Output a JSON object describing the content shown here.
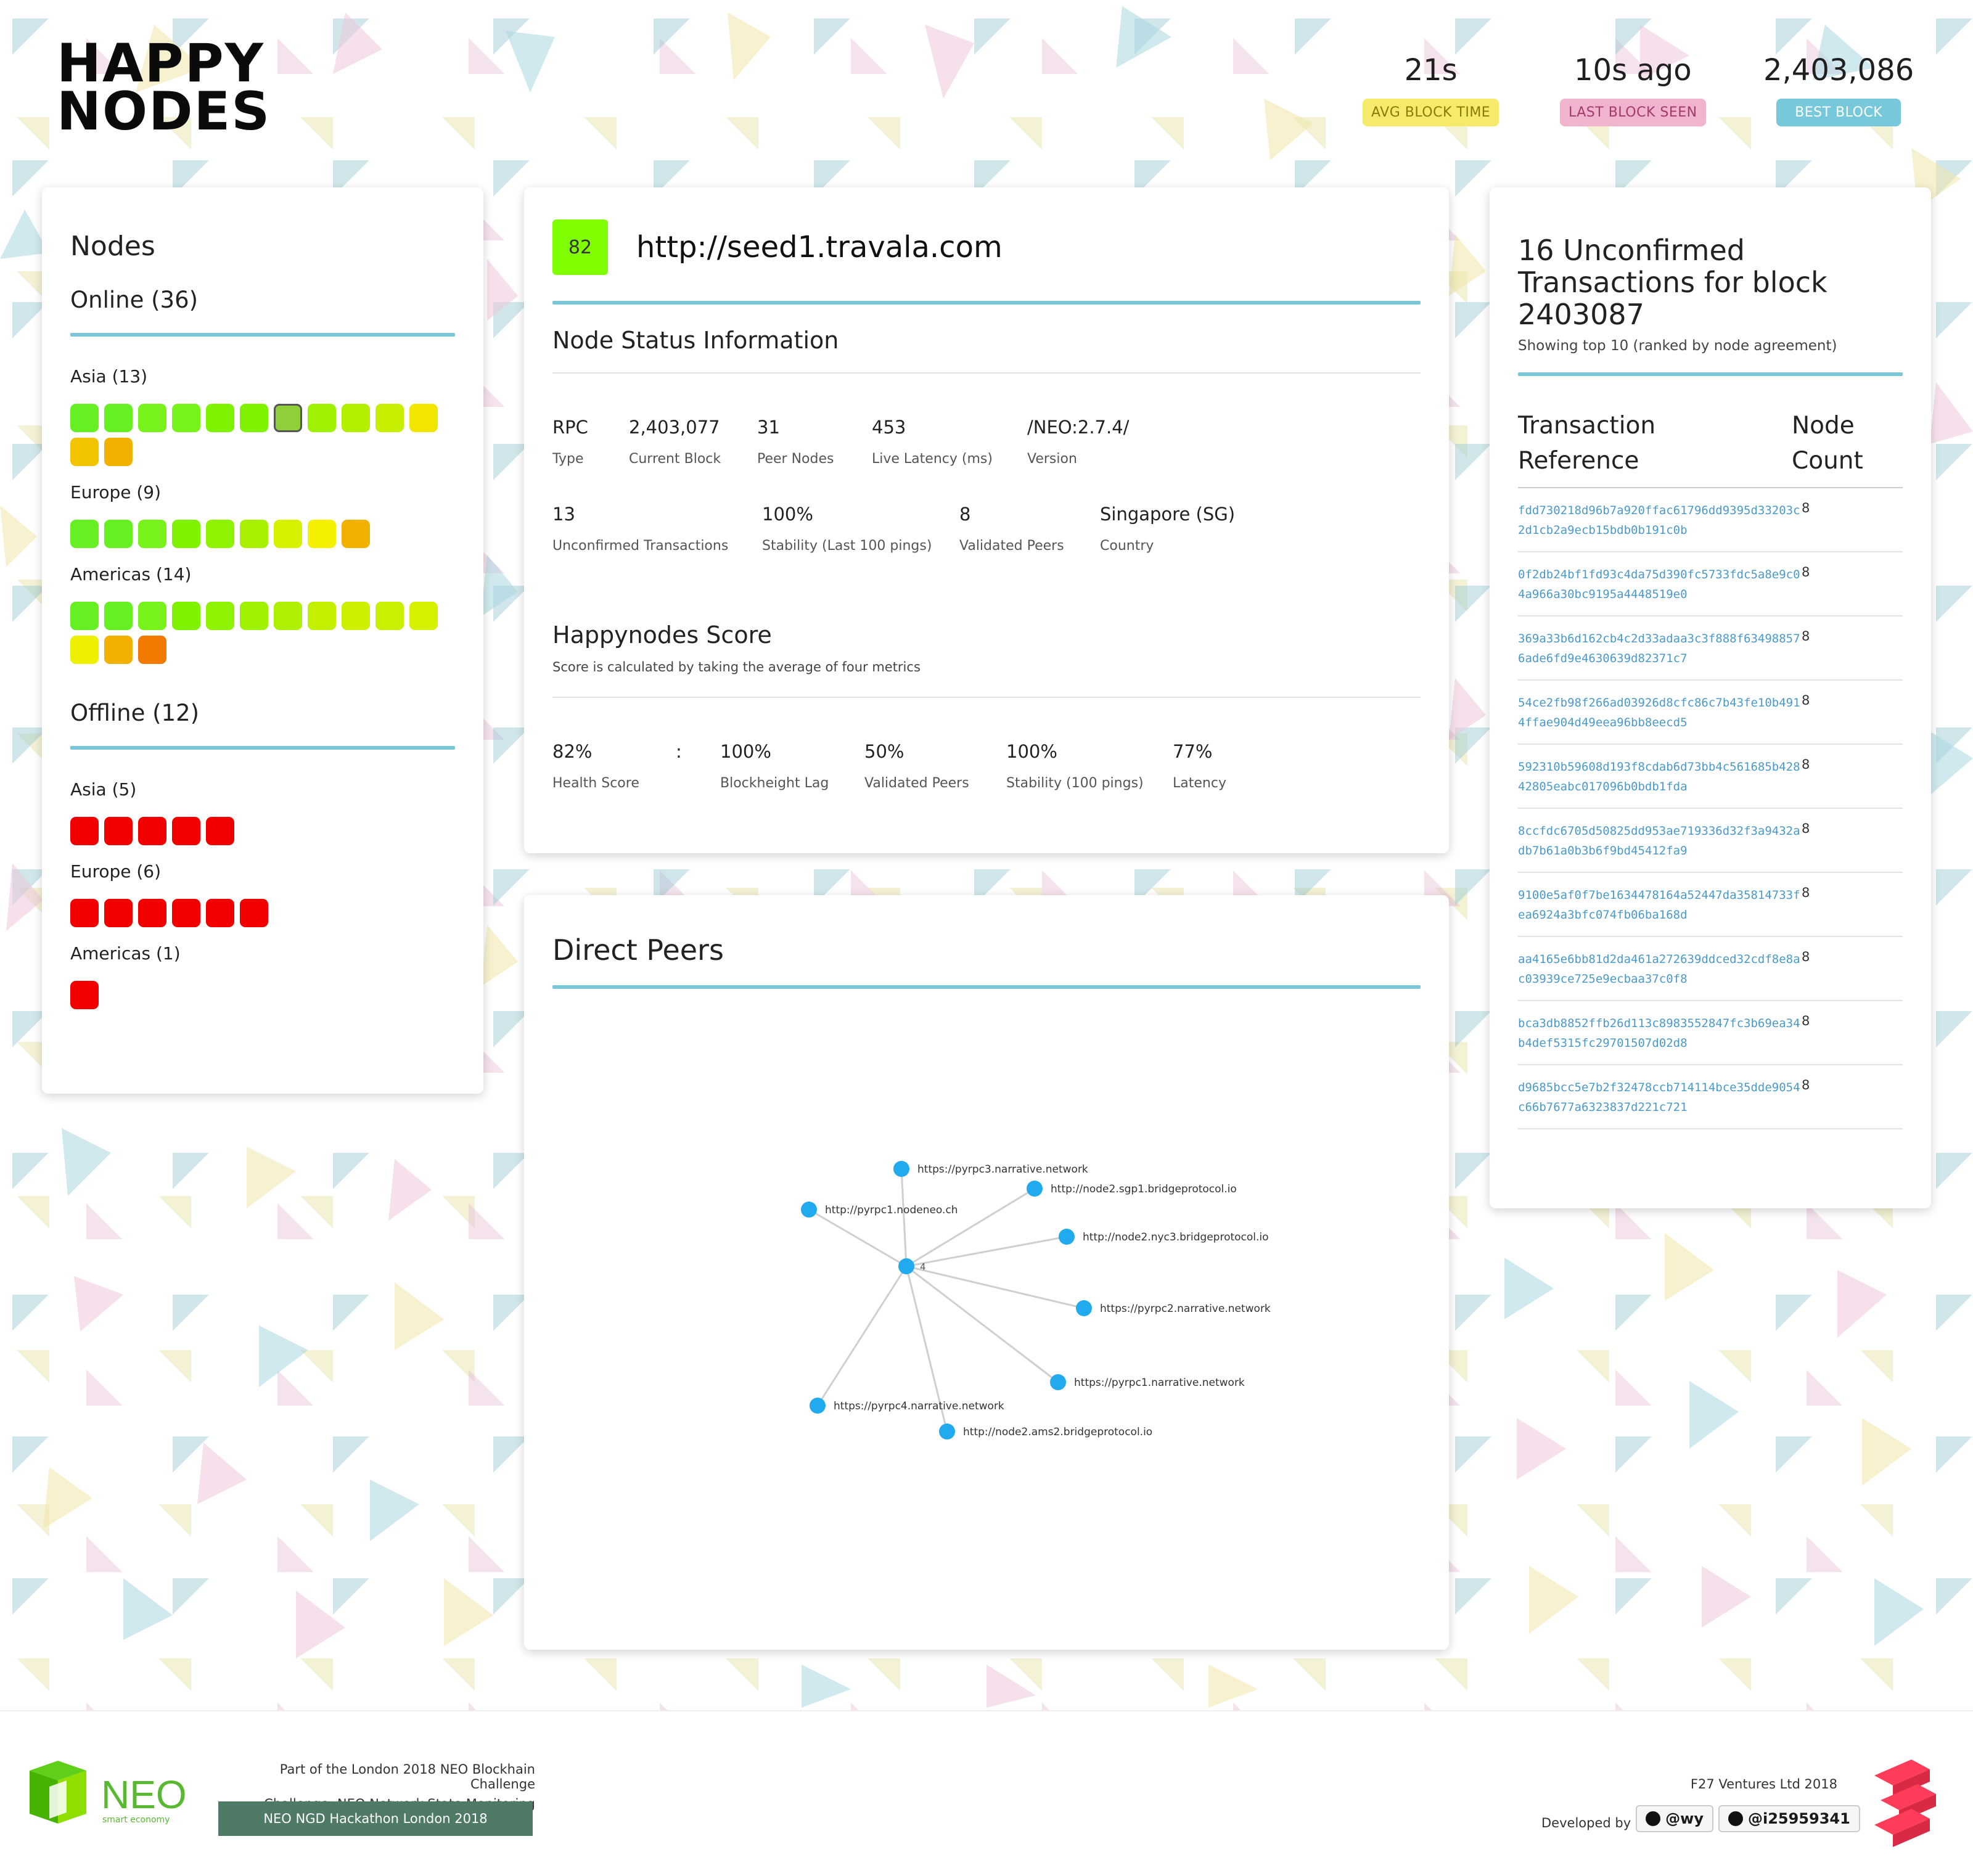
{
  "brand": {
    "line1": "HAPPY",
    "line2": "NODES"
  },
  "stats": [
    {
      "value": "21s",
      "label": "AVG BLOCK TIME",
      "bg": "#f5ea6b",
      "fg": "#8a7b00"
    },
    {
      "value": "10s ago",
      "label": "LAST BLOCK SEEN",
      "bg": "#f1b4cf",
      "fg": "#a23a6a"
    },
    {
      "value": "2,403,086",
      "label": "BEST BLOCK",
      "bg": "#78c8dc",
      "fg": "#ffffff"
    }
  ],
  "nodes": {
    "title": "Nodes",
    "online_title": "Online (36)",
    "offline_title": "Offline (12)",
    "online": [
      {
        "label": "Asia (13)",
        "colors": [
          "#66ef22",
          "#66ef22",
          "#77f21a",
          "#77f21a",
          "#7ff200",
          "#7ff200",
          "#8fcf3a",
          "#9ef200",
          "#b2f000",
          "#c6f000",
          "#f2e600",
          "#f2c400",
          "#f2b000"
        ]
      },
      {
        "label": "Europe (9)",
        "colors": [
          "#66ef22",
          "#66ef22",
          "#77f21a",
          "#7ff200",
          "#8ef200",
          "#a8f000",
          "#d6f000",
          "#f5f000",
          "#f2b000"
        ]
      },
      {
        "label": "Americas (14)",
        "colors": [
          "#66ef22",
          "#66ef22",
          "#77f21a",
          "#7ff200",
          "#8ef200",
          "#9ef200",
          "#aef000",
          "#c2f000",
          "#ccf000",
          "#c9f000",
          "#d7f000",
          "#eef000",
          "#f2b000",
          "#f27a00"
        ]
      }
    ],
    "offline": [
      {
        "label": "Asia (5)",
        "colors": [
          "#f20000",
          "#f20000",
          "#f20000",
          "#f20000",
          "#f20000"
        ]
      },
      {
        "label": "Europe (6)",
        "colors": [
          "#f20000",
          "#f20000",
          "#f20000",
          "#f20000",
          "#f20000",
          "#f20000"
        ]
      },
      {
        "label": "Americas (1)",
        "colors": [
          "#f20000"
        ]
      }
    ]
  },
  "node": {
    "score": "82",
    "url": "http://seed1.travala.com",
    "status_title": "Node Status Information",
    "row1": [
      {
        "value": "RPC",
        "label": "Type"
      },
      {
        "value": "2,403,077",
        "label": "Current Block"
      },
      {
        "value": "31",
        "label": "Peer Nodes"
      },
      {
        "value": "453",
        "label": "Live Latency (ms)"
      },
      {
        "value": "/NEO:2.7.4/",
        "label": "Version"
      }
    ],
    "row2": [
      {
        "value": "13",
        "label": "Unconfirmed Transactions"
      },
      {
        "value": "100%",
        "label": "Stability (Last 100 pings)"
      },
      {
        "value": "8",
        "label": "Validated Peers"
      },
      {
        "value": "Singapore (SG)",
        "label": "Country"
      }
    ],
    "score_title": "Happynodes Score",
    "score_note": "Score is calculated by taking the average of four metrics",
    "score_row": [
      {
        "value": "82%",
        "label": "Health Score"
      },
      {
        "value": ":",
        "label": ""
      },
      {
        "value": "100%",
        "label": "Blockheight Lag"
      },
      {
        "value": "50%",
        "label": "Validated Peers"
      },
      {
        "value": "100%",
        "label": "Stability (100 pings)"
      },
      {
        "value": "77%",
        "label": "Latency"
      }
    ]
  },
  "peers": {
    "title": "Direct Peers",
    "center_label": "4",
    "list": [
      "https://pyrpc3.narrative.network",
      "http://node2.sgp1.bridgeprotocol.io",
      "http://pyrpc1.nodeneo.ch",
      "http://node2.nyc3.bridgeprotocol.io",
      "https://pyrpc2.narrative.network",
      "https://pyrpc1.narrative.network",
      "https://pyrpc4.narrative.network",
      "http://node2.ams2.bridgeprotocol.io"
    ]
  },
  "tx": {
    "title": "16 Unconfirmed Transactions for block 2403087",
    "note": "Showing top 10 (ranked by node agreement)",
    "col_ref": "Transaction Reference",
    "col_count": "Node Count",
    "rows": [
      {
        "hash": "fdd730218d96b7a920ffac61796dd9395d33203c2d1cb2a9ecb15bdb0b191c0b",
        "count": "8"
      },
      {
        "hash": "0f2db24bf1fd93c4da75d390fc5733fdc5a8e9c04a966a30bc9195a4448519e0",
        "count": "8"
      },
      {
        "hash": "369a33b6d162cb4c2d33adaa3c3f888f634988576ade6fd9e4630639d82371c7",
        "count": "8"
      },
      {
        "hash": "54ce2fb98f266ad03926d8cfc86c7b43fe10b4914ffae904d49eea96bb8eecd5",
        "count": "8"
      },
      {
        "hash": "592310b59608d193f8cdab6d73bb4c561685b42842805eabc017096b0bdb1fda",
        "count": "8"
      },
      {
        "hash": "8ccfdc6705d50825dd953ae719336d32f3a9432adb7b61a0b3b6f9bd45412fa9",
        "count": "8"
      },
      {
        "hash": "9100e5af0f7be1634478164a52447da35814733fea6924a3bfc074fb06ba168d",
        "count": "8"
      },
      {
        "hash": "aa4165e6bb81d2da461a272639ddced32cdf8e8ac03939ce725e9ecbaa37c0f8",
        "count": "8"
      },
      {
        "hash": "bca3db8852ffb26d113c8983552847fc3b69ea34b4def5315fc29701507d02d8",
        "count": "8"
      },
      {
        "hash": "d9685bcc5e7b2f32478ccb714114bce35dde9054c66b7677a6323837d221c721",
        "count": "8"
      }
    ]
  },
  "footer": {
    "neo_text": "NEO",
    "neo_sub": "smart economy",
    "part_of": "Part of the London 2018 NEO Blockhain Challenge",
    "challenge": "Challenge: NEO Network State Monitoring",
    "hackathon": "NEO NGD Hackathon London 2018",
    "company": "F27 Ventures Ltd 2018",
    "developed_by": "Developed by",
    "dev1": "@wy",
    "dev2": "@i25959341"
  }
}
